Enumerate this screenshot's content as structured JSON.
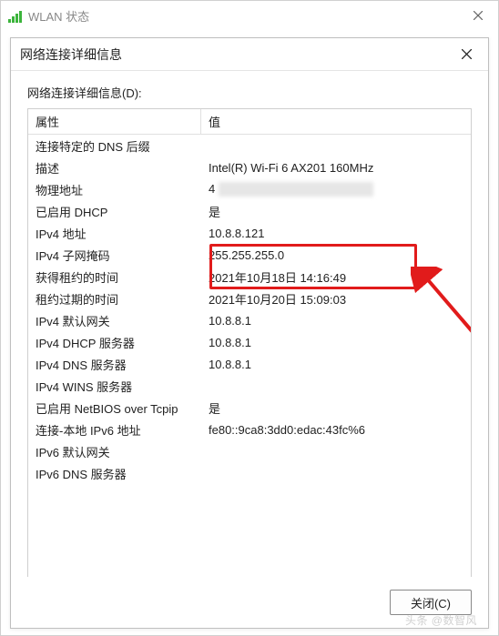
{
  "outer": {
    "title": "WLAN 状态"
  },
  "inner": {
    "title": "网络连接详细信息"
  },
  "section_label": "网络连接详细信息(D):",
  "table": {
    "header_prop": "属性",
    "header_val": "值"
  },
  "rows": [
    {
      "prop": "连接特定的 DNS 后缀",
      "val": ""
    },
    {
      "prop": "描述",
      "val": "Intel(R) Wi-Fi 6 AX201 160MHz"
    },
    {
      "prop": "物理地址",
      "val": "4"
    },
    {
      "prop": "已启用 DHCP",
      "val": "是"
    },
    {
      "prop": "IPv4 地址",
      "val": "10.8.8.121"
    },
    {
      "prop": "IPv4 子网掩码",
      "val": "255.255.255.0"
    },
    {
      "prop": "获得租约的时间",
      "val": "2021年10月18日 14:16:49"
    },
    {
      "prop": "租约过期的时间",
      "val": "2021年10月20日 15:09:03"
    },
    {
      "prop": "IPv4 默认网关",
      "val": "10.8.8.1"
    },
    {
      "prop": "IPv4 DHCP 服务器",
      "val": "10.8.8.1"
    },
    {
      "prop": "IPv4 DNS 服务器",
      "val": "10.8.8.1"
    },
    {
      "prop": "IPv4 WINS 服务器",
      "val": ""
    },
    {
      "prop": "已启用 NetBIOS over Tcpip",
      "val": "是"
    },
    {
      "prop": "连接-本地 IPv6 地址",
      "val": "fe80::9ca8:3dd0:edac:43fc%6"
    },
    {
      "prop": "IPv6 默认网关",
      "val": ""
    },
    {
      "prop": "IPv6 DNS 服务器",
      "val": ""
    }
  ],
  "close_button": "关闭(C)",
  "watermark": "头条 @数智风",
  "highlight_color": "#e11b1b"
}
